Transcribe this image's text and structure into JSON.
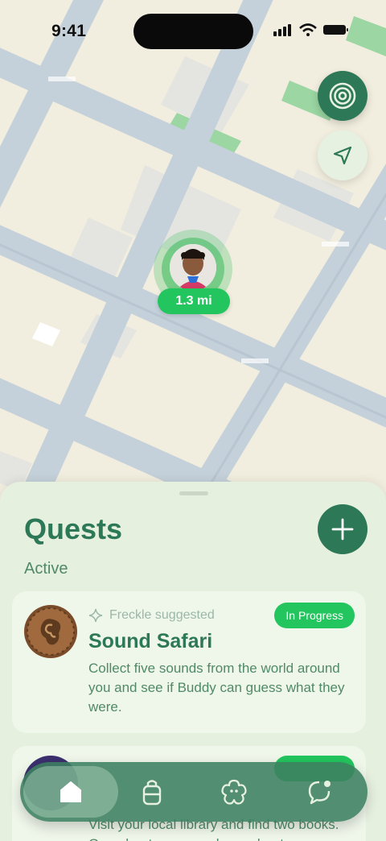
{
  "status_bar": {
    "time": "9:41"
  },
  "map": {
    "distance_label": "1.3 mi"
  },
  "sheet": {
    "title": "Quests",
    "section_label": "Active"
  },
  "quests": [
    {
      "suggested_by": "Freckle suggested",
      "status": "In Progress",
      "title": "Sound Safari",
      "description": "Collect five sounds from the world around you and see if Buddy can guess what they were."
    },
    {
      "description": "Visit your local library and find two books. One about space and one about"
    }
  ],
  "colors": {
    "brand_green": "#2d7856",
    "status_green": "#22c55e",
    "sheet_bg": "#e6f0df"
  },
  "icons": {
    "radar": "radar-icon",
    "locate": "navigation-arrow-icon",
    "add": "plus-icon",
    "suggest": "sparkle-icon",
    "tabs": [
      "home-icon",
      "backpack-icon",
      "flower-icon",
      "chat-icon"
    ]
  }
}
